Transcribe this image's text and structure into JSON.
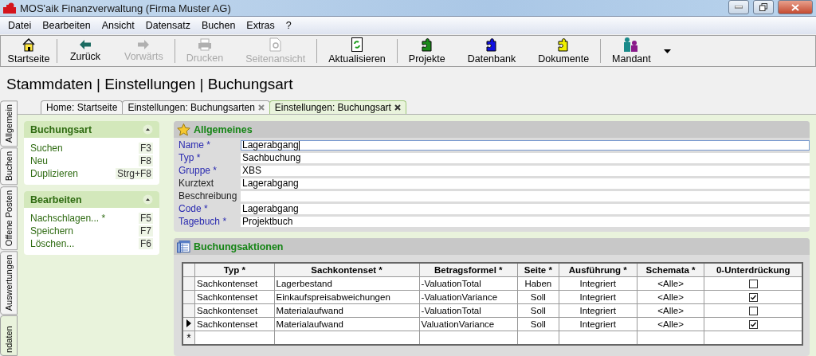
{
  "window": {
    "title": "MOS'aik Finanzverwaltung (Firma Muster AG)"
  },
  "menu": [
    "Datei",
    "Bearbeiten",
    "Ansicht",
    "Datensatz",
    "Buchen",
    "Extras",
    "?"
  ],
  "toolbar_groups": [
    [
      {
        "kind": "home",
        "label": "Startseite",
        "disabled": false
      }
    ],
    [
      {
        "kind": "back",
        "label": "Zurück",
        "disabled": false
      },
      {
        "kind": "forward",
        "label": "Vorwärts",
        "disabled": true
      }
    ],
    [
      {
        "kind": "print",
        "label": "Drucken",
        "disabled": true
      },
      {
        "kind": "preview",
        "label": "Seitenansicht",
        "disabled": true
      }
    ],
    [
      {
        "kind": "refresh",
        "label": "Aktualisieren",
        "disabled": false
      }
    ],
    [
      {
        "kind": "puzzle",
        "color": "#1a8a1a",
        "label": "Projekte",
        "disabled": false
      },
      {
        "kind": "puzzle",
        "color": "#1010e0",
        "label": "Datenbank",
        "disabled": false
      },
      {
        "kind": "puzzle",
        "color": "#f0f000",
        "label": "Dokumente",
        "disabled": false
      }
    ],
    [
      {
        "kind": "people",
        "label": "Mandant",
        "disabled": false
      }
    ]
  ],
  "breadcrumb": "Stammdaten | Einstellungen | Buchungsart",
  "vertical_tabs": [
    {
      "label": "Allgemein",
      "selected": false
    },
    {
      "label": "Buchen",
      "selected": false
    },
    {
      "label": "Offene Posten",
      "selected": false
    },
    {
      "label": "Auswertungen",
      "selected": false
    },
    {
      "label": "ndaten",
      "selected": true
    }
  ],
  "doc_tabs": [
    {
      "label": "Home: Startseite",
      "closable": false,
      "selected": false
    },
    {
      "label": "Einstellungen: Buchungsarten",
      "closable": true,
      "selected": false
    },
    {
      "label": "Einstellungen: Buchungsart",
      "closable": true,
      "selected": true
    }
  ],
  "side_sections": [
    {
      "title": "Buchungsart",
      "items": [
        {
          "label": "Suchen",
          "shortcut": "F3"
        },
        {
          "label": "Neu",
          "shortcut": "F8"
        },
        {
          "label": "Duplizieren",
          "shortcut": "Strg+F8"
        }
      ]
    },
    {
      "title": "Bearbeiten",
      "items": [
        {
          "label": "Nachschlagen... *",
          "shortcut": "F5"
        },
        {
          "label": "Speichern",
          "shortcut": "F7"
        },
        {
          "label": "Löschen...",
          "shortcut": "F6"
        }
      ]
    }
  ],
  "general": {
    "title": "Allgemeines",
    "fields": [
      {
        "label": "Name *",
        "value": "Lagerabgang",
        "required": true,
        "focused": true
      },
      {
        "label": "Typ *",
        "value": "Sachbuchung",
        "required": true,
        "focused": false
      },
      {
        "label": "Gruppe *",
        "value": "XBS",
        "required": true,
        "focused": false
      },
      {
        "label": "Kurztext",
        "value": "Lagerabgang",
        "required": false,
        "focused": false
      },
      {
        "label": "Beschreibung",
        "required": false,
        "focused": false
      },
      {
        "label": "Code *",
        "value": "Lagerabgang",
        "required": true,
        "focused": false
      },
      {
        "label": "Tagebuch *",
        "value": "Projektbuch",
        "required": true,
        "focused": false
      }
    ]
  },
  "actions": {
    "title": "Buchungsaktionen",
    "columns": [
      "Typ *",
      "Sachkontenset *",
      "Betragsformel *",
      "Seite *",
      "Ausführung *",
      "Schemata *",
      "0-Unterdrückung"
    ],
    "rows": [
      {
        "selected": false,
        "cells": [
          "Sachkontenset",
          "Lagerbestand",
          "-ValuationTotal",
          "Haben",
          "Integriert",
          "<Alle>"
        ],
        "checked": false
      },
      {
        "selected": false,
        "cells": [
          "Sachkontenset",
          "Einkaufspreisabweichungen",
          "-ValuationVariance",
          "Soll",
          "Integriert",
          "<Alle>"
        ],
        "checked": true
      },
      {
        "selected": false,
        "cells": [
          "Sachkontenset",
          "Materialaufwand",
          "-ValuationTotal",
          "Soll",
          "Integriert",
          "<Alle>"
        ],
        "checked": false
      },
      {
        "selected": true,
        "cells": [
          "Sachkontenset",
          "Materialaufwand",
          "ValuationVariance",
          "Soll",
          "Integriert",
          "<Alle>"
        ],
        "checked": true
      }
    ],
    "new_row_marker": "*"
  }
}
